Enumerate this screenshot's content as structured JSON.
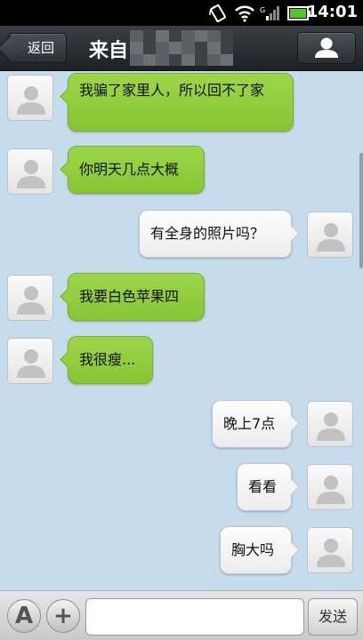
{
  "status_bar": {
    "time": "14:01",
    "icons": [
      "rotate-icon",
      "wifi-icon",
      "signal-icon",
      "battery-icon"
    ]
  },
  "header": {
    "back_label": "返回",
    "title": "来自"
  },
  "messages": [
    {
      "side": "left",
      "text": "我骗了家里人，所以回不了家"
    },
    {
      "side": "left",
      "text": "你明天几点大概"
    },
    {
      "side": "right",
      "text": "有全身的照片吗？"
    },
    {
      "side": "left",
      "text": "我要白色苹果四"
    },
    {
      "side": "left",
      "text": "我很瘦..."
    },
    {
      "side": "right",
      "text": "晚上7点"
    },
    {
      "side": "right",
      "text": "看看"
    },
    {
      "side": "right",
      "text": "胸大吗"
    }
  ],
  "input_bar": {
    "font_button": "A",
    "add_button": "+",
    "input_value": "",
    "send_label": "发送"
  },
  "colors": {
    "incoming_bubble": "#93cf40",
    "outgoing_bubble": "#f4f4f4",
    "chat_background": "#c6dcec"
  }
}
